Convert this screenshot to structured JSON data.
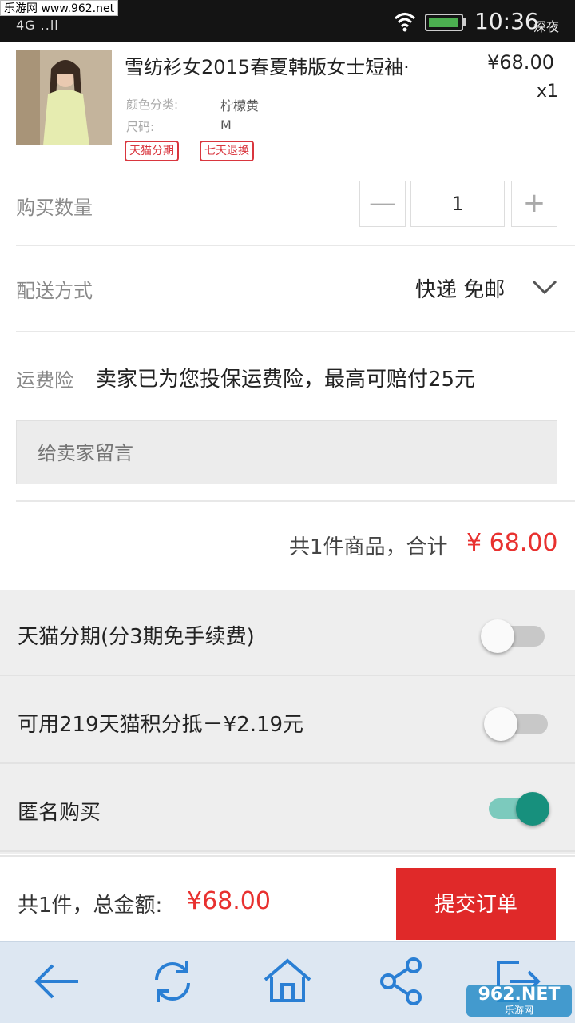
{
  "status_bar": {
    "watermark": "乐游网 www.962.net",
    "signal": "4G ..ll",
    "time": "10:36",
    "time_suffix": "深夜"
  },
  "product": {
    "title": "雪纺衫女2015春夏韩版女士短袖·",
    "price": "¥68.00",
    "qty": "x1",
    "attributes": [
      {
        "label": "颜色分类:",
        "value": "柠檬黄"
      },
      {
        "label": "尺码:",
        "value": "M"
      }
    ],
    "tags": [
      "天猫分期",
      "七天退换"
    ]
  },
  "quantity": {
    "label": "购买数量",
    "value": "1",
    "minus": "—",
    "plus": "+"
  },
  "shipping": {
    "label": "配送方式",
    "value": "快递 免邮"
  },
  "insurance": {
    "label": "运费险",
    "text": "卖家已为您投保运费险，最高可赔付25元"
  },
  "message": {
    "placeholder": "给卖家留言"
  },
  "summary": {
    "text": "共1件商品，合计",
    "amount": "¥ 68.00"
  },
  "options": [
    {
      "label": "天猫分期(分3期免手续费)",
      "enabled": false
    },
    {
      "label": "可用219天猫积分抵－¥2.19元",
      "enabled": false
    },
    {
      "label": "匿名购买",
      "enabled": true
    }
  ],
  "bottom": {
    "total_label": "共1件，总金额:",
    "total_amount": "¥68.00",
    "submit": "提交订单"
  },
  "nav": {
    "icons": [
      "back-arrow-icon",
      "refresh-icon",
      "home-icon",
      "share-icon",
      "exit-icon"
    ],
    "watermark": "962.NET",
    "watermark_sub": "乐游网"
  },
  "colors": {
    "accent_red": "#e02929",
    "price_red": "#e8312f",
    "toggle_on": "#17907d",
    "nav_icon": "#2a7fd4"
  }
}
